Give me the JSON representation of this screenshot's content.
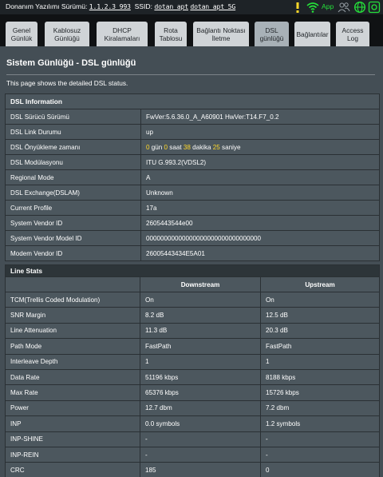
{
  "topbar": {
    "fw_label": "Donanım Yazılımı Sürümü:",
    "fw_version": "1.1.2.3_993",
    "ssid_label": "SSID:",
    "ssid_1": "dotan_apt",
    "ssid_2": "dotan_apt_5G",
    "app_label": "App"
  },
  "tabs": [
    {
      "label": "Genel\nGünlük"
    },
    {
      "label": "Kablosuz\nGünlüğü"
    },
    {
      "label": "DHCP\nKiralamaları"
    },
    {
      "label": "Rota\nTablosu"
    },
    {
      "label": "Bağlantı Noktası\nİletme"
    },
    {
      "label": "DSL\ngünlüğü"
    },
    {
      "label": "Bağlantılar"
    },
    {
      "label": "Access\nLog"
    }
  ],
  "page": {
    "title": "Sistem Günlüğü - DSL günlüğü",
    "description": "This page shows the detailed DSL status."
  },
  "dsl_info": {
    "heading": "DSL Information",
    "rows": [
      {
        "label": "DSL Sürücü Sürümü",
        "value": "FwVer:5.6.36.0_A_A60901 HwVer:T14.F7_0.2"
      },
      {
        "label": "DSL Link Durumu",
        "value": "up"
      },
      {
        "label": "DSL Modülasyonu",
        "value": "ITU G.993.2(VDSL2)"
      },
      {
        "label": "Regional Mode",
        "value": "A"
      },
      {
        "label": "DSL Exchange(DSLAM)",
        "value": "Unknown"
      },
      {
        "label": "Current Profile",
        "value": "17a"
      },
      {
        "label": "System Vendor ID",
        "value": "2605443544e00"
      },
      {
        "label": "System Vendor Model ID",
        "value": "00000000000000000000000000000000"
      },
      {
        "label": "Modem Vendor ID",
        "value": "26005443434E5A01"
      }
    ],
    "uptime": {
      "label": "DSL Önyükleme zamanı",
      "days": "0",
      "days_unit": "gün",
      "hours": "0",
      "hours_unit": "saat",
      "minutes": "38",
      "minutes_unit": "dakika",
      "seconds": "25",
      "seconds_unit": "saniye"
    }
  },
  "line_stats": {
    "heading": "Line Stats",
    "col_down": "Downstream",
    "col_up": "Upstream",
    "rows": [
      {
        "label": "TCM(Trellis Coded Modulation)",
        "down": "On",
        "up": "On"
      },
      {
        "label": "SNR Margin",
        "down": "8.2 dB",
        "up": "12.5 dB"
      },
      {
        "label": "Line Attenuation",
        "down": "11.3 dB",
        "up": "20.3 dB"
      },
      {
        "label": "Path Mode",
        "down": "FastPath",
        "up": "FastPath"
      },
      {
        "label": "Interleave Depth",
        "down": "1",
        "up": "1"
      },
      {
        "label": "Data Rate",
        "down": "51196 kbps",
        "up": "8188 kbps"
      },
      {
        "label": "Max Rate",
        "down": "65376 kbps",
        "up": "15726 kbps"
      },
      {
        "label": "Power",
        "down": "12.7 dbm",
        "up": "7.2 dbm"
      },
      {
        "label": "INP",
        "down": "0.0 symbols",
        "up": "1.2 symbols"
      },
      {
        "label": "INP-SHINE",
        "down": "-",
        "up": "-"
      },
      {
        "label": "INP-REIN",
        "down": "-",
        "up": "-"
      },
      {
        "label": "CRC",
        "down": "185",
        "up": "0"
      }
    ]
  },
  "colors": {
    "accent": "#ffd82a",
    "app": "#25e03a",
    "panel": "#444e55"
  }
}
